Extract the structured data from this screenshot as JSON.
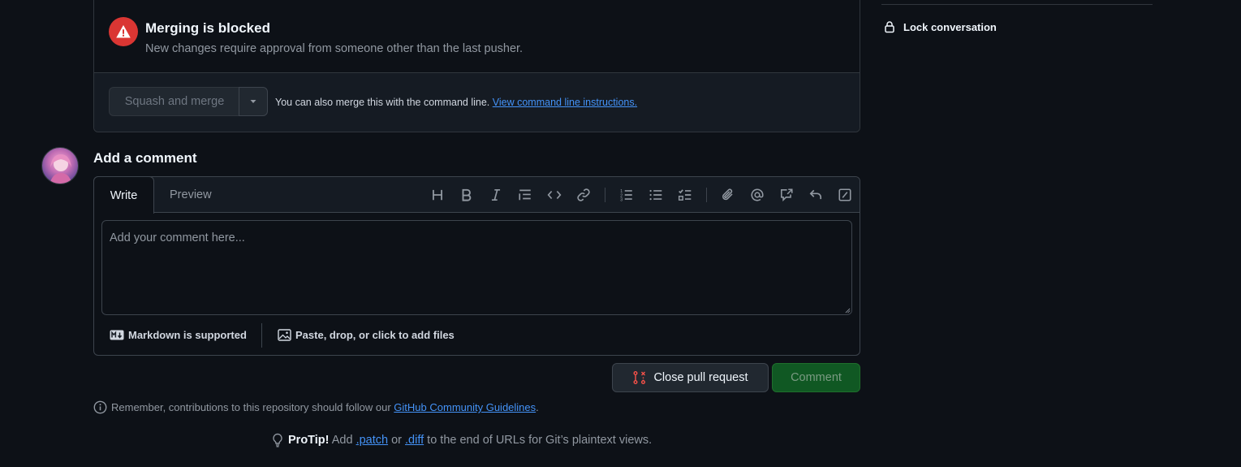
{
  "merge": {
    "title": "Merging is blocked",
    "description": "New changes require approval from someone other than the last pusher.",
    "squash_label": "Squash and merge",
    "cmd_text": "You can also merge this with the command line.",
    "cmd_link": "View command line instructions."
  },
  "sidebar": {
    "lock_label": "Lock conversation"
  },
  "comment": {
    "heading": "Add a comment",
    "tab_write": "Write",
    "tab_preview": "Preview",
    "placeholder": "Add your comment here...",
    "markdown_note": "Markdown is supported",
    "files_note": "Paste, drop, or click to add files",
    "close_pr_label": "Close pull request",
    "comment_label": "Comment"
  },
  "footer": {
    "guidelines_text": "Remember, contributions to this repository should follow our",
    "guidelines_link": "GitHub Community Guidelines",
    "guidelines_end": ".",
    "protip_label": "ProTip!",
    "protip_pre": "Add",
    "protip_patch": ".patch",
    "protip_or": "or",
    "protip_diff": ".diff",
    "protip_post": "to the end of URLs for Git’s plaintext views."
  },
  "colors": {
    "background": "#0d1117",
    "danger": "#da3633",
    "link": "#4493f8",
    "comment_button": "#105823"
  }
}
